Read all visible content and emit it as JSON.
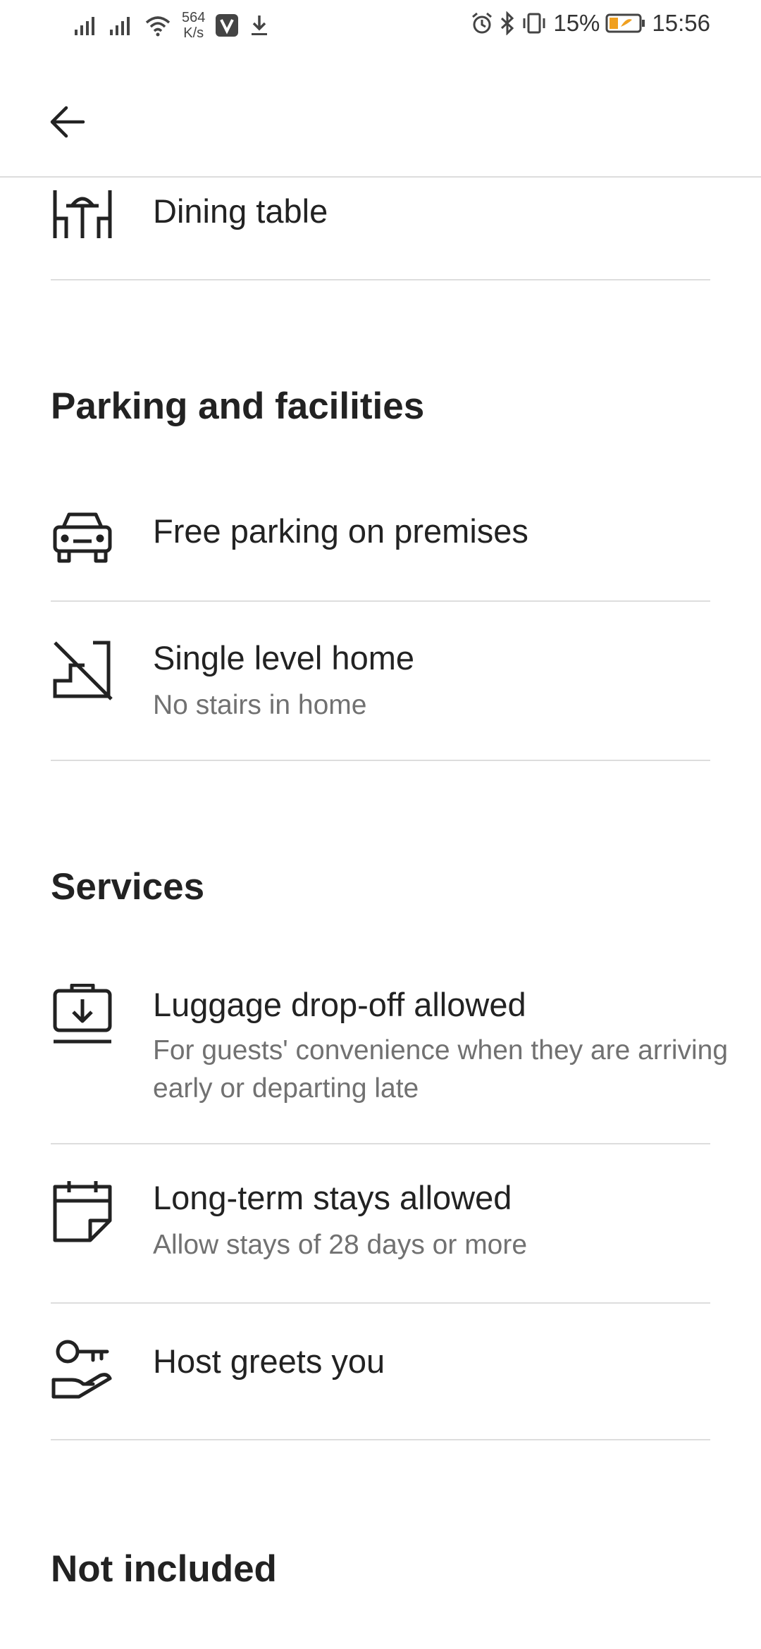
{
  "status_bar": {
    "speed_value": "564",
    "speed_unit": "K/s",
    "battery": "15%",
    "time": "15:56"
  },
  "amenities": {
    "dining": {
      "title": "Dining table"
    },
    "parking_section": "Parking and facilities",
    "parking": {
      "title": "Free parking on premises"
    },
    "single_level": {
      "title": "Single level home",
      "subtitle": "No stairs in home"
    },
    "services_section": "Services",
    "luggage": {
      "title": "Luggage drop-off allowed",
      "subtitle": "For guests' convenience when they are arriving early or departing late"
    },
    "long_term": {
      "title": "Long-term stays allowed",
      "subtitle": "Allow stays of 28 days or more"
    },
    "host_greets": {
      "title": "Host greets you"
    },
    "not_included_section": "Not included"
  }
}
